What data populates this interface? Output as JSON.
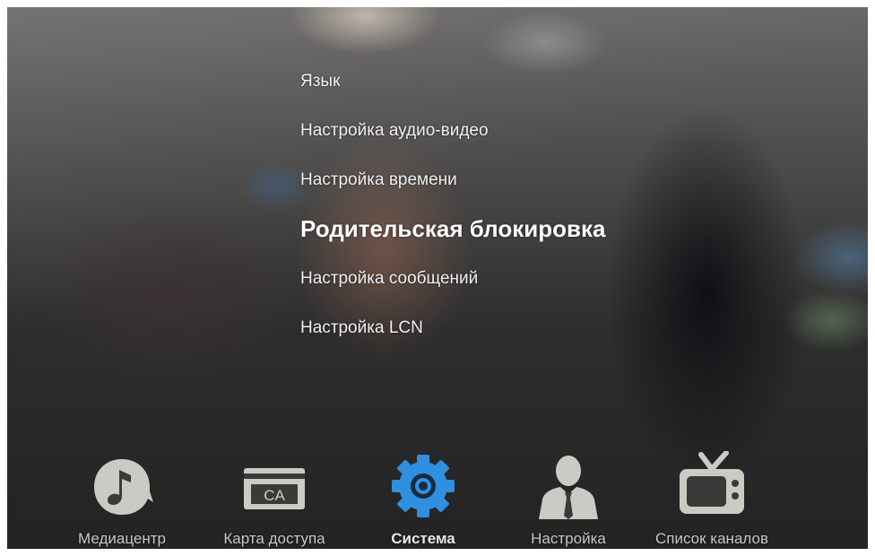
{
  "colors": {
    "menu_text": "#f1f1f1",
    "icon_inactive": "#cbcbc5",
    "icon_active": "#2f8fe0",
    "label_text": "#c9c9c9"
  },
  "settings_menu": {
    "items": [
      {
        "label": "Язык",
        "selected": false
      },
      {
        "label": "Настройка аудио-видео",
        "selected": false
      },
      {
        "label": "Настройка времени",
        "selected": false
      },
      {
        "label": "Родительская блокировка",
        "selected": true
      },
      {
        "label": "Настройка сообщений",
        "selected": false
      },
      {
        "label": "Настройка LCN",
        "selected": false
      }
    ]
  },
  "dock": {
    "items": [
      {
        "label": "Медиацентр",
        "icon": "music-note-icon",
        "active": false
      },
      {
        "label": "Карта доступа",
        "icon": "ca-card-icon",
        "icon_text": "CA",
        "active": false
      },
      {
        "label": "Система",
        "icon": "gear-icon",
        "active": true
      },
      {
        "label": "Настройка",
        "icon": "user-icon",
        "active": false
      },
      {
        "label": "Список каналов",
        "icon": "tv-icon",
        "active": false
      }
    ]
  }
}
